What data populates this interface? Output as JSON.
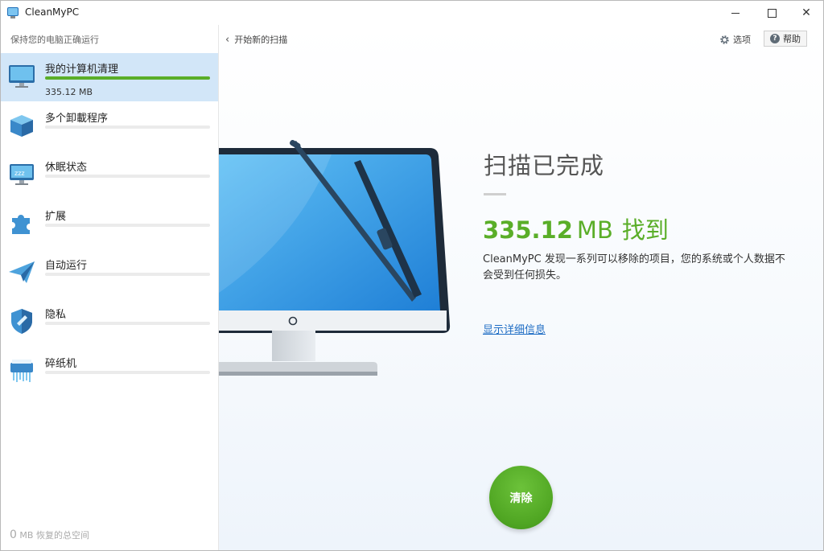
{
  "window": {
    "title": "CleanMyPC"
  },
  "sidebar": {
    "tagline": "保持您的电脑正确运行",
    "items": [
      {
        "label": "我的计算机清理",
        "size": "335.12 MB",
        "progress": 1.0,
        "active": true,
        "icon": "monitor-icon"
      },
      {
        "label": "多个卸載程序",
        "progress": 0,
        "active": false,
        "icon": "box-icon"
      },
      {
        "label": "休眠状态",
        "progress": 0,
        "active": false,
        "icon": "sleep-monitor-icon"
      },
      {
        "label": "扩展",
        "progress": 0,
        "active": false,
        "icon": "puzzle-icon"
      },
      {
        "label": "自动运行",
        "progress": 0,
        "active": false,
        "icon": "paper-plane-icon"
      },
      {
        "label": "隐私",
        "progress": 0,
        "active": false,
        "icon": "shield-icon"
      },
      {
        "label": "碎纸机",
        "progress": 0,
        "active": false,
        "icon": "shredder-icon"
      }
    ],
    "footer": {
      "amount": "0",
      "unit": "MB 恢复的总空间"
    }
  },
  "header": {
    "back_label": "开始新的扫描",
    "settings_label": "选项",
    "help_label": "帮助"
  },
  "result": {
    "title": "扫描已完成",
    "found_amount": "335.12",
    "found_unit": "MB",
    "found_text": "找到",
    "description": "CleanMyPC 发现一系列可以移除的项目，您的系统或个人数据不会受到任何损失。",
    "details_link": "显示详细信息",
    "clean_button": "清除"
  },
  "colors": {
    "accent_green": "#5aae28",
    "active_item_bg": "#d2e6f8",
    "link_blue": "#1d6cc4"
  }
}
